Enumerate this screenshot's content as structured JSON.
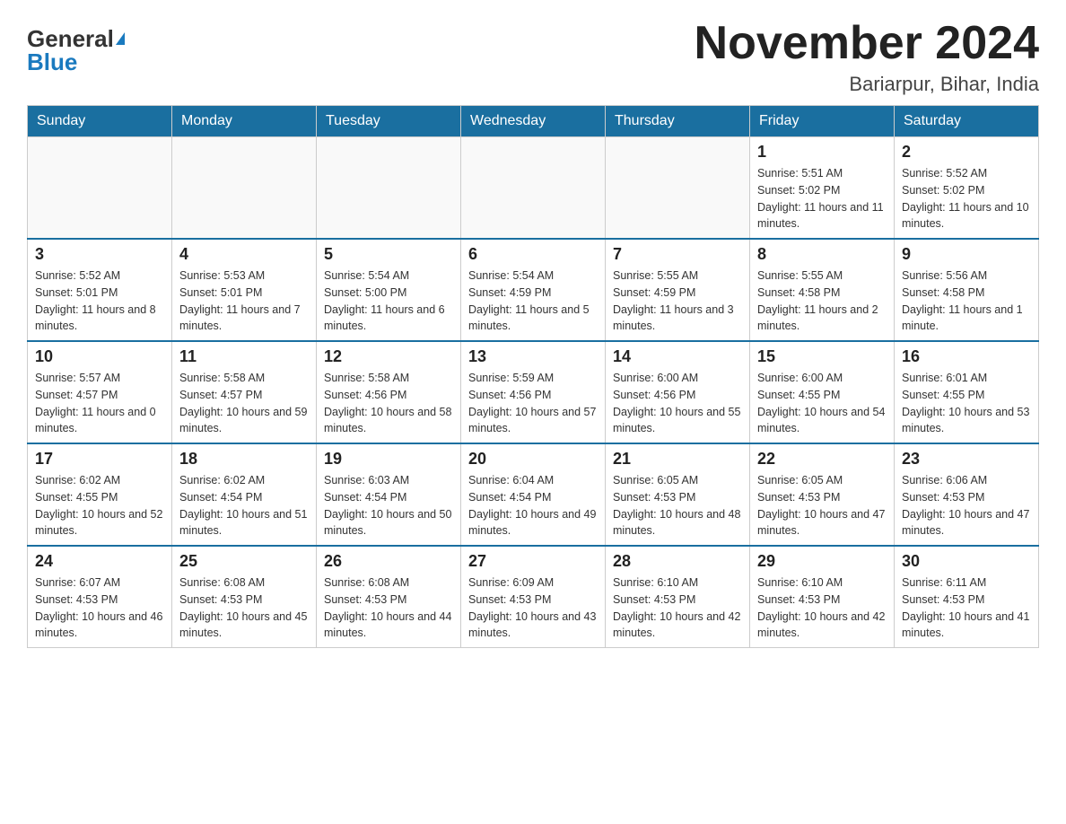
{
  "header": {
    "logo_general": "General",
    "logo_blue": "Blue",
    "month_title": "November 2024",
    "location": "Bariarpur, Bihar, India"
  },
  "weekdays": [
    "Sunday",
    "Monday",
    "Tuesday",
    "Wednesday",
    "Thursday",
    "Friday",
    "Saturday"
  ],
  "weeks": [
    [
      {
        "day": "",
        "sunrise": "",
        "sunset": "",
        "daylight": ""
      },
      {
        "day": "",
        "sunrise": "",
        "sunset": "",
        "daylight": ""
      },
      {
        "day": "",
        "sunrise": "",
        "sunset": "",
        "daylight": ""
      },
      {
        "day": "",
        "sunrise": "",
        "sunset": "",
        "daylight": ""
      },
      {
        "day": "",
        "sunrise": "",
        "sunset": "",
        "daylight": ""
      },
      {
        "day": "1",
        "sunrise": "Sunrise: 5:51 AM",
        "sunset": "Sunset: 5:02 PM",
        "daylight": "Daylight: 11 hours and 11 minutes."
      },
      {
        "day": "2",
        "sunrise": "Sunrise: 5:52 AM",
        "sunset": "Sunset: 5:02 PM",
        "daylight": "Daylight: 11 hours and 10 minutes."
      }
    ],
    [
      {
        "day": "3",
        "sunrise": "Sunrise: 5:52 AM",
        "sunset": "Sunset: 5:01 PM",
        "daylight": "Daylight: 11 hours and 8 minutes."
      },
      {
        "day": "4",
        "sunrise": "Sunrise: 5:53 AM",
        "sunset": "Sunset: 5:01 PM",
        "daylight": "Daylight: 11 hours and 7 minutes."
      },
      {
        "day": "5",
        "sunrise": "Sunrise: 5:54 AM",
        "sunset": "Sunset: 5:00 PM",
        "daylight": "Daylight: 11 hours and 6 minutes."
      },
      {
        "day": "6",
        "sunrise": "Sunrise: 5:54 AM",
        "sunset": "Sunset: 4:59 PM",
        "daylight": "Daylight: 11 hours and 5 minutes."
      },
      {
        "day": "7",
        "sunrise": "Sunrise: 5:55 AM",
        "sunset": "Sunset: 4:59 PM",
        "daylight": "Daylight: 11 hours and 3 minutes."
      },
      {
        "day": "8",
        "sunrise": "Sunrise: 5:55 AM",
        "sunset": "Sunset: 4:58 PM",
        "daylight": "Daylight: 11 hours and 2 minutes."
      },
      {
        "day": "9",
        "sunrise": "Sunrise: 5:56 AM",
        "sunset": "Sunset: 4:58 PM",
        "daylight": "Daylight: 11 hours and 1 minute."
      }
    ],
    [
      {
        "day": "10",
        "sunrise": "Sunrise: 5:57 AM",
        "sunset": "Sunset: 4:57 PM",
        "daylight": "Daylight: 11 hours and 0 minutes."
      },
      {
        "day": "11",
        "sunrise": "Sunrise: 5:58 AM",
        "sunset": "Sunset: 4:57 PM",
        "daylight": "Daylight: 10 hours and 59 minutes."
      },
      {
        "day": "12",
        "sunrise": "Sunrise: 5:58 AM",
        "sunset": "Sunset: 4:56 PM",
        "daylight": "Daylight: 10 hours and 58 minutes."
      },
      {
        "day": "13",
        "sunrise": "Sunrise: 5:59 AM",
        "sunset": "Sunset: 4:56 PM",
        "daylight": "Daylight: 10 hours and 57 minutes."
      },
      {
        "day": "14",
        "sunrise": "Sunrise: 6:00 AM",
        "sunset": "Sunset: 4:56 PM",
        "daylight": "Daylight: 10 hours and 55 minutes."
      },
      {
        "day": "15",
        "sunrise": "Sunrise: 6:00 AM",
        "sunset": "Sunset: 4:55 PM",
        "daylight": "Daylight: 10 hours and 54 minutes."
      },
      {
        "day": "16",
        "sunrise": "Sunrise: 6:01 AM",
        "sunset": "Sunset: 4:55 PM",
        "daylight": "Daylight: 10 hours and 53 minutes."
      }
    ],
    [
      {
        "day": "17",
        "sunrise": "Sunrise: 6:02 AM",
        "sunset": "Sunset: 4:55 PM",
        "daylight": "Daylight: 10 hours and 52 minutes."
      },
      {
        "day": "18",
        "sunrise": "Sunrise: 6:02 AM",
        "sunset": "Sunset: 4:54 PM",
        "daylight": "Daylight: 10 hours and 51 minutes."
      },
      {
        "day": "19",
        "sunrise": "Sunrise: 6:03 AM",
        "sunset": "Sunset: 4:54 PM",
        "daylight": "Daylight: 10 hours and 50 minutes."
      },
      {
        "day": "20",
        "sunrise": "Sunrise: 6:04 AM",
        "sunset": "Sunset: 4:54 PM",
        "daylight": "Daylight: 10 hours and 49 minutes."
      },
      {
        "day": "21",
        "sunrise": "Sunrise: 6:05 AM",
        "sunset": "Sunset: 4:53 PM",
        "daylight": "Daylight: 10 hours and 48 minutes."
      },
      {
        "day": "22",
        "sunrise": "Sunrise: 6:05 AM",
        "sunset": "Sunset: 4:53 PM",
        "daylight": "Daylight: 10 hours and 47 minutes."
      },
      {
        "day": "23",
        "sunrise": "Sunrise: 6:06 AM",
        "sunset": "Sunset: 4:53 PM",
        "daylight": "Daylight: 10 hours and 47 minutes."
      }
    ],
    [
      {
        "day": "24",
        "sunrise": "Sunrise: 6:07 AM",
        "sunset": "Sunset: 4:53 PM",
        "daylight": "Daylight: 10 hours and 46 minutes."
      },
      {
        "day": "25",
        "sunrise": "Sunrise: 6:08 AM",
        "sunset": "Sunset: 4:53 PM",
        "daylight": "Daylight: 10 hours and 45 minutes."
      },
      {
        "day": "26",
        "sunrise": "Sunrise: 6:08 AM",
        "sunset": "Sunset: 4:53 PM",
        "daylight": "Daylight: 10 hours and 44 minutes."
      },
      {
        "day": "27",
        "sunrise": "Sunrise: 6:09 AM",
        "sunset": "Sunset: 4:53 PM",
        "daylight": "Daylight: 10 hours and 43 minutes."
      },
      {
        "day": "28",
        "sunrise": "Sunrise: 6:10 AM",
        "sunset": "Sunset: 4:53 PM",
        "daylight": "Daylight: 10 hours and 42 minutes."
      },
      {
        "day": "29",
        "sunrise": "Sunrise: 6:10 AM",
        "sunset": "Sunset: 4:53 PM",
        "daylight": "Daylight: 10 hours and 42 minutes."
      },
      {
        "day": "30",
        "sunrise": "Sunrise: 6:11 AM",
        "sunset": "Sunset: 4:53 PM",
        "daylight": "Daylight: 10 hours and 41 minutes."
      }
    ]
  ]
}
